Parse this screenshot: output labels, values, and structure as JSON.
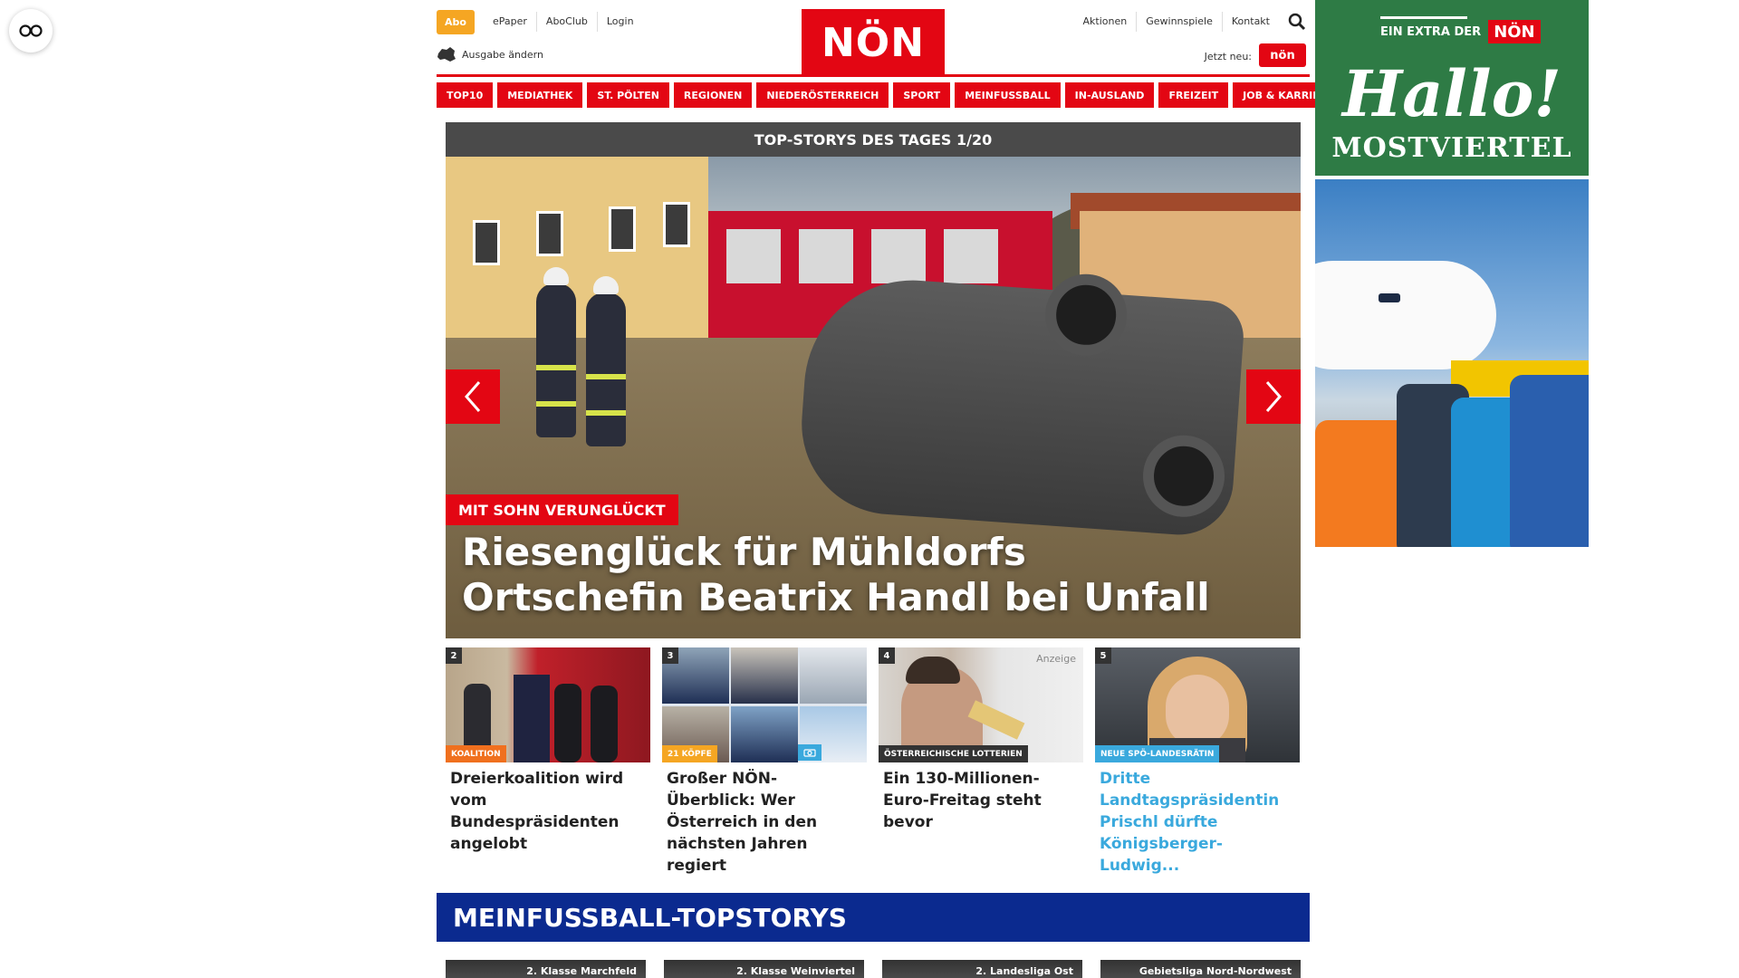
{
  "header": {
    "abo": "Abo",
    "left_links": [
      "ePaper",
      "AboClub",
      "Login"
    ],
    "ausgabe": "Ausgabe ändern",
    "logo": "NÖN",
    "right_links": [
      "Aktionen",
      "Gewinnspiele",
      "Kontakt"
    ],
    "jetzt": "Jetzt neu:",
    "jetzt_logo": "nön"
  },
  "nav": [
    "TOP10",
    "MEDIATHEK",
    "ST. PÖLTEN",
    "REGIONEN",
    "NIEDERÖSTERREICH",
    "SPORT",
    "MEINFUSSBALL",
    "IN-AUSLAND",
    "FREIZEIT",
    "JOB & KARRIERE"
  ],
  "slider": {
    "heading": "TOP-STORYS DES TAGES 1/20",
    "kicker": "MIT SOHN VERUNGLÜCKT",
    "headline": "Riesenglück für Mühldorfs Ortschefin Beatrix Handl bei Unfall"
  },
  "teasers": [
    {
      "num": "2",
      "label": "KOALITION",
      "label_color": "#f0701e",
      "title": "Dreierkoalition wird vom Bundespräsidenten angelobt",
      "title_color": "default"
    },
    {
      "num": "3",
      "label": "21 KÖPFE",
      "label_color": "#f5a623",
      "title": "Großer NÖN-Überblick: Wer Österreich in den nächsten Jahren regiert",
      "title_color": "default"
    },
    {
      "num": "4",
      "label": "ÖSTERREICHISCHE LOTTERIEN",
      "label_color": "#333333",
      "anzeige": "Anzeige",
      "title": "Ein 130-Millionen-Euro-Freitag steht bevor",
      "title_color": "default"
    },
    {
      "num": "5",
      "label": "NEUE SPÖ-LANDESRÄTIN",
      "label_color": "#3aa9dd",
      "title": "Dritte Landtagspräsidentin Prischl dürfte Königsberger-Ludwig...",
      "title_color": "blue"
    }
  ],
  "meinfussball": {
    "heading": "MEINFUSSBALL-TOPSTORYS",
    "cards": [
      "2. Klasse Marchfeld",
      "2. Klasse Weinviertel",
      "2. Landesliga Ost",
      "Gebietsliga Nord-Nordwest"
    ]
  },
  "ad": {
    "extra": "EIN EXTRA DER",
    "extra_logo": "NÖN",
    "hallo": "Hallo!",
    "region": "MOSTVIERTEL"
  }
}
